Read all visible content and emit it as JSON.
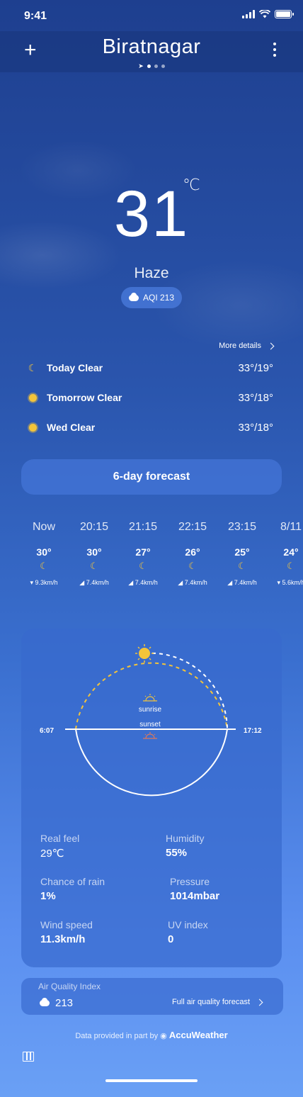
{
  "status": {
    "time": "9:41"
  },
  "header": {
    "city": "Biratnagar",
    "add_label": "+"
  },
  "current": {
    "temp": "31",
    "unit": "℃",
    "condition": "Haze",
    "aqi": "AQI 213"
  },
  "daily": {
    "more_details": "More details",
    "days": [
      {
        "label": "Today Clear",
        "temps": "33°/19°",
        "icon": "moon-icon"
      },
      {
        "label": "Tomorrow Clear",
        "temps": "33°/18°",
        "icon": "sun-icon"
      },
      {
        "label": "Wed Clear",
        "temps": "33°/18°",
        "icon": "sun-icon"
      }
    ],
    "six_day_button": "6-day forecast"
  },
  "hourly": [
    {
      "time": "Now",
      "temp": "30°",
      "wind": "9.3km/h"
    },
    {
      "time": "20:15",
      "temp": "30°",
      "wind": "7.4km/h"
    },
    {
      "time": "21:15",
      "temp": "27°",
      "wind": "7.4km/h"
    },
    {
      "time": "22:15",
      "temp": "26°",
      "wind": "7.4km/h"
    },
    {
      "time": "23:15",
      "temp": "25°",
      "wind": "7.4km/h"
    },
    {
      "time": "8/11",
      "temp": "24°",
      "wind": "5.6km/h"
    }
  ],
  "sun": {
    "sunrise_label": "sunrise",
    "sunset_label": "sunset",
    "sunrise_time": "6:07",
    "sunset_time": "17:12"
  },
  "details": {
    "real_feel_label": "Real feel",
    "real_feel": "29℃",
    "humidity_label": "Humidity",
    "humidity": "55%",
    "rain_label": "Chance of rain",
    "rain": "1%",
    "pressure_label": "Pressure",
    "pressure": "1014mbar",
    "wind_label": "Wind speed",
    "wind": "11.3km/h",
    "uv_label": "UV index",
    "uv": "0"
  },
  "air_quality": {
    "title": "Air Quality Index",
    "value": "213",
    "link": "Full air quality forecast"
  },
  "footer": {
    "provided": "Data provided in part by",
    "brand": "AccuWeather"
  },
  "colors": {
    "sun": "#f3c43a",
    "sunset": "#e0785a"
  }
}
